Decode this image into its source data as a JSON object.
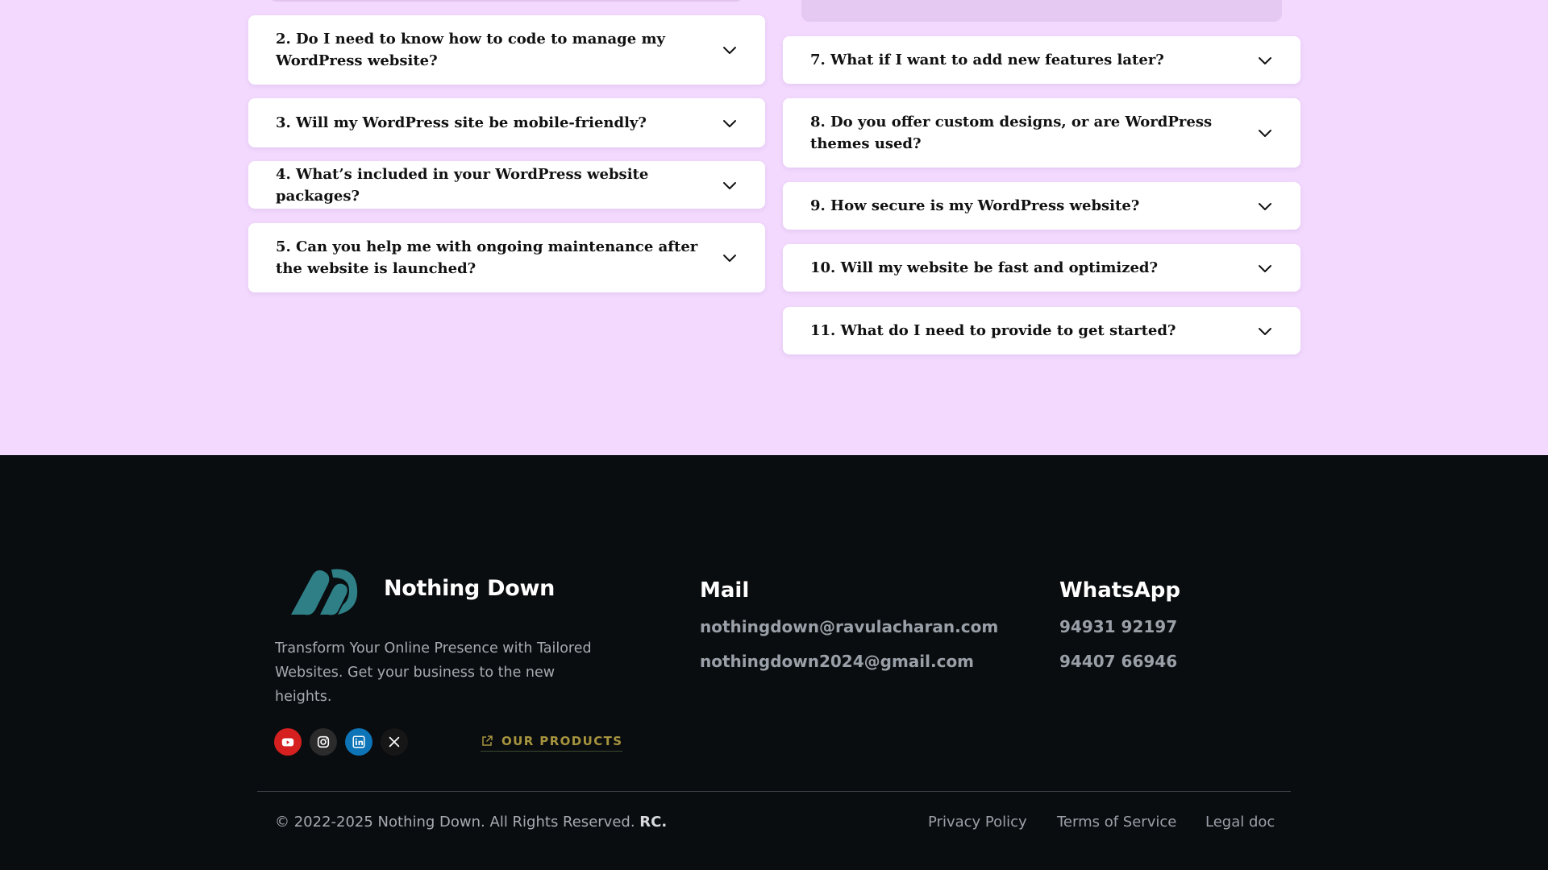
{
  "faq": {
    "left": [
      {
        "question": "2. Do I need to know how to code to manage my WordPress website?"
      },
      {
        "question": "3. Will my WordPress site be mobile-friendly?"
      },
      {
        "question": "4. What’s included in your WordPress website packages?"
      },
      {
        "question": "5. Can you help me with ongoing maintenance after the website is launched?"
      }
    ],
    "right": [
      {
        "question": "7. What if I want to add new features later?"
      },
      {
        "question": "8. Do you offer custom designs, or are WordPress themes used?"
      },
      {
        "question": "9. How secure is my WordPress website?"
      },
      {
        "question": "10. Will my website be fast and optimized?"
      },
      {
        "question": "11. What do I need to provide to get started?"
      }
    ],
    "icon": "chevron-down-icon"
  },
  "footer": {
    "brand_name": "Nothing Down",
    "tagline": "Transform Your Online Presence with Tailored Websites. Get your business to the new heights.",
    "socials": [
      "youtube-icon",
      "instagram-icon",
      "linkedin-icon",
      "x-icon"
    ],
    "products_label": "OUR PRODUCTS",
    "mail": {
      "heading": "Mail",
      "addresses": [
        "nothingdown@ravulacharan.com",
        "nothingdown2024@gmail.com"
      ]
    },
    "whatsapp": {
      "heading": "WhatsApp",
      "numbers": [
        "94931 92197",
        "94407 66946"
      ]
    },
    "copyright": "© 2022-2025 Nothing Down. All Rights Reserved.",
    "copyright_mark": "RC.",
    "links": [
      "Privacy Policy",
      "Terms of Service",
      "Legal doc"
    ]
  },
  "colors": {
    "page_bg": "#f2d9fd",
    "footer_bg": "#0a0d10",
    "logo_teal": "#2e7f86",
    "products_gold": "#a6943e"
  }
}
